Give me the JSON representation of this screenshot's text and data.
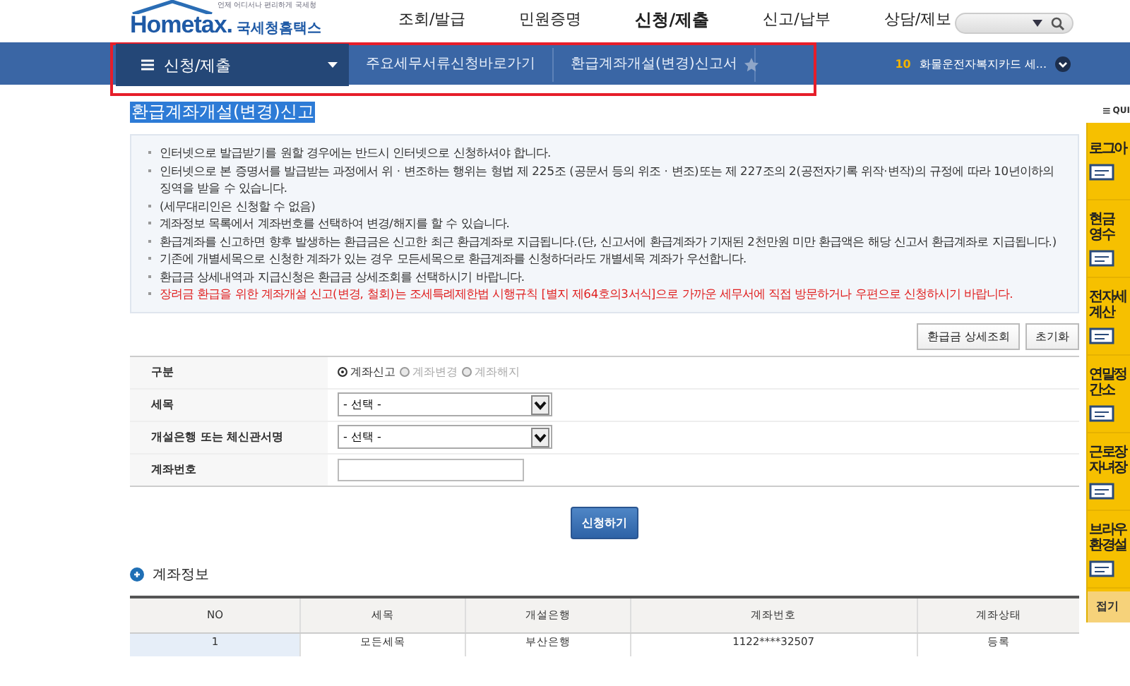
{
  "header": {
    "logo_tagline": "언제 어디서나 편리하게 국세청",
    "logo_brand": "Hometax.",
    "logo_name": "국세청홈택스",
    "menu": [
      {
        "label": "조회/발급",
        "selected": false
      },
      {
        "label": "민원증명",
        "selected": false
      },
      {
        "label": "신청/제출",
        "selected": true
      },
      {
        "label": "신고/납부",
        "selected": false
      },
      {
        "label": "상담/제보",
        "selected": false
      }
    ]
  },
  "navbar": {
    "menu_label": "신청/제출",
    "breadcrumbs": [
      "주요세무서류신청바로가기",
      "환급계좌개설(변경)신고서"
    ],
    "highlighted": true,
    "ticker_number": "10",
    "ticker_text": "화물운전자복지카드 세..."
  },
  "page_title": "환급계좌개설(변경)신고",
  "notices": [
    {
      "text": "인터넷으로 발급받기를 원할 경우에는 반드시 인터넷으로 신청하셔야 합니다.",
      "warning": false
    },
    {
      "text": "인터넷으로 본 증명서를 발급받는 과정에서 위 · 변조하는 행위는 형법 제 225조 (공문서 등의 위조 · 변조)또는 제 227조의 2(공전자기록 위작·변작)의 규정에 따라 10년이하의 징역을 받을 수 있습니다.",
      "warning": false
    },
    {
      "text": "(세무대리인은 신청할 수 없음)",
      "warning": false
    },
    {
      "text": "계좌정보 목록에서 계좌번호를 선택하여 변경/해지를 할 수 있습니다.",
      "warning": false
    },
    {
      "text": "환급계좌를 신고하면 향후 발생하는 환급금은 신고한 최근 환급계좌로 지급됩니다.(단, 신고서에 환급계좌가 기재된 2천만원 미만 환급액은 해당 신고서 환급계좌로 지급됩니다.)",
      "warning": false
    },
    {
      "text": "기존에 개별세목으로 신청한 계좌가 있는 경우 모든세목으로 환급계좌를 신청하더라도 개별세목 계좌가 우선합니다.",
      "warning": false
    },
    {
      "text": "환급금 상세내역과 지급신청은 환급금 상세조회를 선택하시기 바랍니다.",
      "warning": false
    },
    {
      "text": "장려금 환급을 위한 계좌개설 신고(변경, 철회)는 조세특례제한법 시행규칙 [별지 제64호의3서식]으로 가까운 세무서에 직접 방문하거나 우편으로 신청하시기 바랍니다.",
      "warning": true
    }
  ],
  "action_buttons": [
    "환급금 상세조회",
    "초기화"
  ],
  "form": [
    {
      "kind": "radio",
      "label": "구분",
      "options": [
        {
          "label": "계좌신고",
          "selected": true,
          "disabled": false
        },
        {
          "label": "계좌변경",
          "selected": false,
          "disabled": true
        },
        {
          "label": "계좌해지",
          "selected": false,
          "disabled": true
        }
      ]
    },
    {
      "kind": "select",
      "label": "세목",
      "value": "- 선택 -"
    },
    {
      "kind": "select",
      "label": "개설은행 또는 체신관서명",
      "value": "- 선택 -"
    },
    {
      "kind": "text",
      "label": "계좌번호"
    }
  ],
  "submit_button": "신청하기",
  "account_section": {
    "title": "계좌정보",
    "columns": [
      "NO",
      "세목",
      "개설은행",
      "계좌번호",
      "계좌상태"
    ],
    "rows": [
      [
        "1",
        "모든세목",
        "부산은행",
        "1122****32507",
        "등록"
      ]
    ]
  },
  "quick_menu": {
    "title": "QUI",
    "items": [
      {
        "label": "로그아"
      },
      {
        "label": "현금\n영수"
      },
      {
        "label": "전자세\n계산"
      },
      {
        "label": "연말정\n간소"
      },
      {
        "label": "근로장\n자녀장"
      },
      {
        "label": "브라우\n환경설"
      }
    ],
    "collapse": "접기"
  }
}
